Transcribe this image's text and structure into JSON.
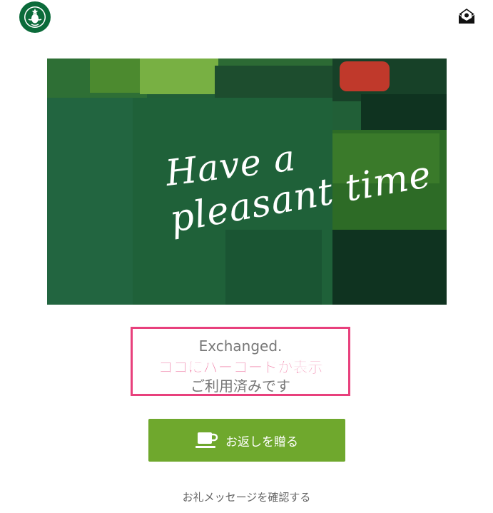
{
  "header": {
    "logo_icon": "starbucks-siren-logo-icon",
    "mail_icon": "open-envelope-icon"
  },
  "card": {
    "line1": "Have a",
    "line2": "pleasant time",
    "colors": {
      "dark_green": "#1e5c38",
      "mid_green": "#2f6a2f",
      "light_green": "#4d8a2e",
      "bright_green": "#78b043",
      "darkest_green": "#0f3320",
      "red": "#c0392b"
    }
  },
  "status": {
    "exchanged": "Exchanged.",
    "barcode_note": "ココにバーコードが表示",
    "used": "ご利用済みです",
    "highlight_color": "#e8407c"
  },
  "actions": {
    "gift_button_label": "お返しを贈る",
    "gift_icon": "coffee-cup-icon",
    "gift_button_color": "#6fa82d",
    "message_link": "お礼メッセージを確認する"
  }
}
